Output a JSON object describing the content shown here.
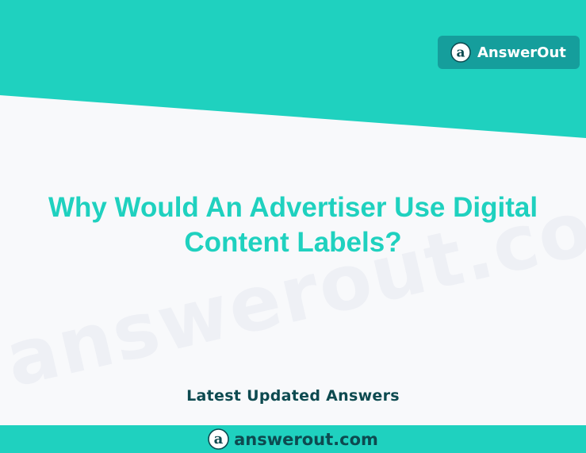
{
  "colors": {
    "accent": "#1fd1bf",
    "badge": "#159e9c",
    "dark_text": "#0d4a50",
    "background": "#f8f9fb"
  },
  "brand": {
    "name": "AnswerOut",
    "logo_icon": "at-sign-a-icon"
  },
  "watermark": "answerout.com",
  "headline": "Why Would An Advertiser Use Digital Content Labels?",
  "subheading": "Latest Updated Answers",
  "footer": {
    "domain": "answerout.com",
    "logo_icon": "at-sign-a-icon"
  }
}
